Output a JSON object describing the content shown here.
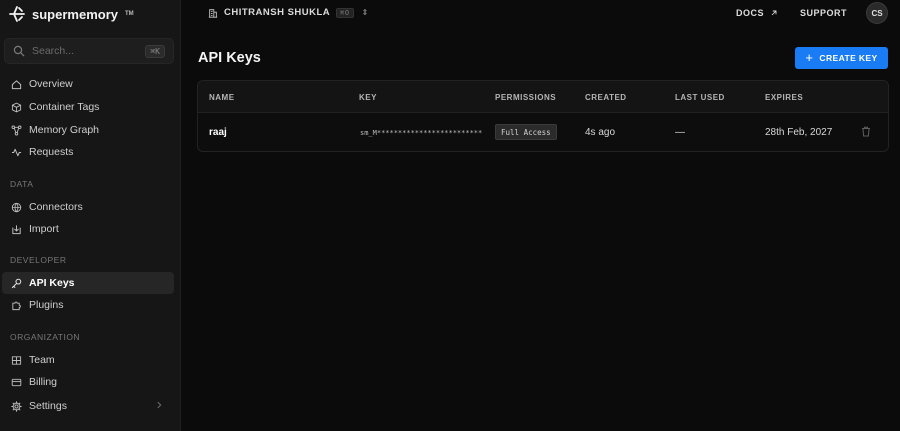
{
  "brand": {
    "name": "supermemory",
    "trademark": "TM"
  },
  "search": {
    "placeholder": "Search...",
    "shortcut": "⌘K"
  },
  "sidebar": {
    "items": [
      {
        "label": "Overview",
        "icon": "home-icon"
      },
      {
        "label": "Container Tags",
        "icon": "box-icon"
      },
      {
        "label": "Memory Graph",
        "icon": "graph-icon"
      },
      {
        "label": "Requests",
        "icon": "activity-icon"
      }
    ],
    "sections": [
      {
        "label": "DATA",
        "items": [
          {
            "label": "Connectors",
            "icon": "globe-icon"
          },
          {
            "label": "Import",
            "icon": "import-icon"
          }
        ]
      },
      {
        "label": "DEVELOPER",
        "items": [
          {
            "label": "API Keys",
            "icon": "key-icon",
            "active": true
          },
          {
            "label": "Plugins",
            "icon": "puzzle-icon"
          }
        ]
      },
      {
        "label": "ORGANIZATION",
        "items": [
          {
            "label": "Team",
            "icon": "team-icon"
          },
          {
            "label": "Billing",
            "icon": "card-icon"
          },
          {
            "label": "Settings",
            "icon": "gear-icon"
          }
        ]
      }
    ]
  },
  "topbar": {
    "org_name": "CHITRANSH SHUKLA",
    "org_shortcut": "⌘O",
    "docs_label": "DOCS",
    "support_label": "SUPPORT",
    "avatar_initials": "CS"
  },
  "main": {
    "title": "API Keys",
    "create_button_label": "CREATE KEY",
    "table": {
      "headers": [
        "NAME",
        "KEY",
        "PERMISSIONS",
        "CREATED",
        "LAST USED",
        "EXPIRES"
      ],
      "rows": [
        {
          "name": "raaj",
          "key": "sm_M************************************",
          "permissions": "Full Access",
          "created": "4s ago",
          "last_used": "—",
          "expires": "28th Feb, 2027"
        }
      ]
    }
  },
  "colors": {
    "accent": "#1a7cf5",
    "background": "#0b0b0b",
    "sidebar": "#161616"
  }
}
